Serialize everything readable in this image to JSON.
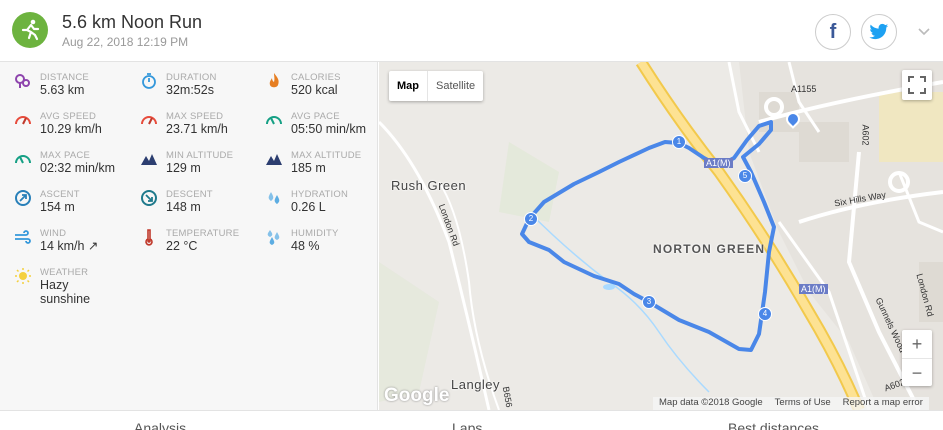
{
  "activity": {
    "title": "5.6 km Noon Run",
    "datetime": "Aug 22, 2018 12:19 PM",
    "sport_icon": "running-person-icon",
    "accent": "#6db33f"
  },
  "share": {
    "facebook_label": "f",
    "twitter_icon": "twitter-bird-icon",
    "expand_icon": "chevron-down-icon"
  },
  "stats": [
    {
      "icon": "distance-pin-icon",
      "label": "DISTANCE",
      "value": "5.63 km"
    },
    {
      "icon": "stopwatch-icon",
      "label": "DURATION",
      "value": "32m:52s"
    },
    {
      "icon": "flame-icon",
      "label": "CALORIES",
      "value": "520 kcal"
    },
    {
      "icon": "speedometer-icon",
      "label": "AVG SPEED",
      "value": "10.29 km/h"
    },
    {
      "icon": "speedometer-icon",
      "label": "MAX SPEED",
      "value": "23.71 km/h"
    },
    {
      "icon": "pace-gauge-icon",
      "label": "AVG PACE",
      "value": "05:50 min/km"
    },
    {
      "icon": "pace-gauge-icon",
      "label": "MAX PACE",
      "value": "02:32 min/km"
    },
    {
      "icon": "mountain-icon",
      "label": "MIN ALTITUDE",
      "value": "129 m"
    },
    {
      "icon": "mountain-icon",
      "label": "MAX ALTITUDE",
      "value": "185 m"
    },
    {
      "icon": "ascent-compass-icon",
      "label": "ASCENT",
      "value": "154 m"
    },
    {
      "icon": "descent-compass-icon",
      "label": "DESCENT",
      "value": "148 m"
    },
    {
      "icon": "water-drops-icon",
      "label": "HYDRATION",
      "value": "0.26 L"
    },
    {
      "icon": "wind-icon",
      "label": "WIND",
      "value": "14 km/h ↗"
    },
    {
      "icon": "thermometer-icon",
      "label": "TEMPERATURE",
      "value": "22 °C"
    },
    {
      "icon": "humidity-drops-icon",
      "label": "HUMIDITY",
      "value": "48 %"
    },
    {
      "icon": "sun-haze-icon",
      "label": "WEATHER",
      "value": "Hazy\nsunshine"
    }
  ],
  "map": {
    "map_button": "Map",
    "satellite_button": "Satellite",
    "zoom_in": "+",
    "zoom_out": "−",
    "logo": "Google",
    "attribution": [
      "Map data ©2018 Google",
      "Terms of Use",
      "Report a map error"
    ],
    "places": [
      "Rush Green",
      "NORTON GREEN",
      "Langley"
    ],
    "roads": [
      "A1155",
      "A602",
      "Six Hills Way",
      "London Rd",
      "London Rd",
      "A1(M)",
      "A1(M)",
      "Gunnels Wood",
      "B656",
      "A602"
    ],
    "route_markers": [
      "1",
      "2",
      "3",
      "4",
      "5"
    ],
    "route_color": "#4a87e8"
  },
  "tabs": [
    "Analysis",
    "Laps",
    "Best distances"
  ]
}
